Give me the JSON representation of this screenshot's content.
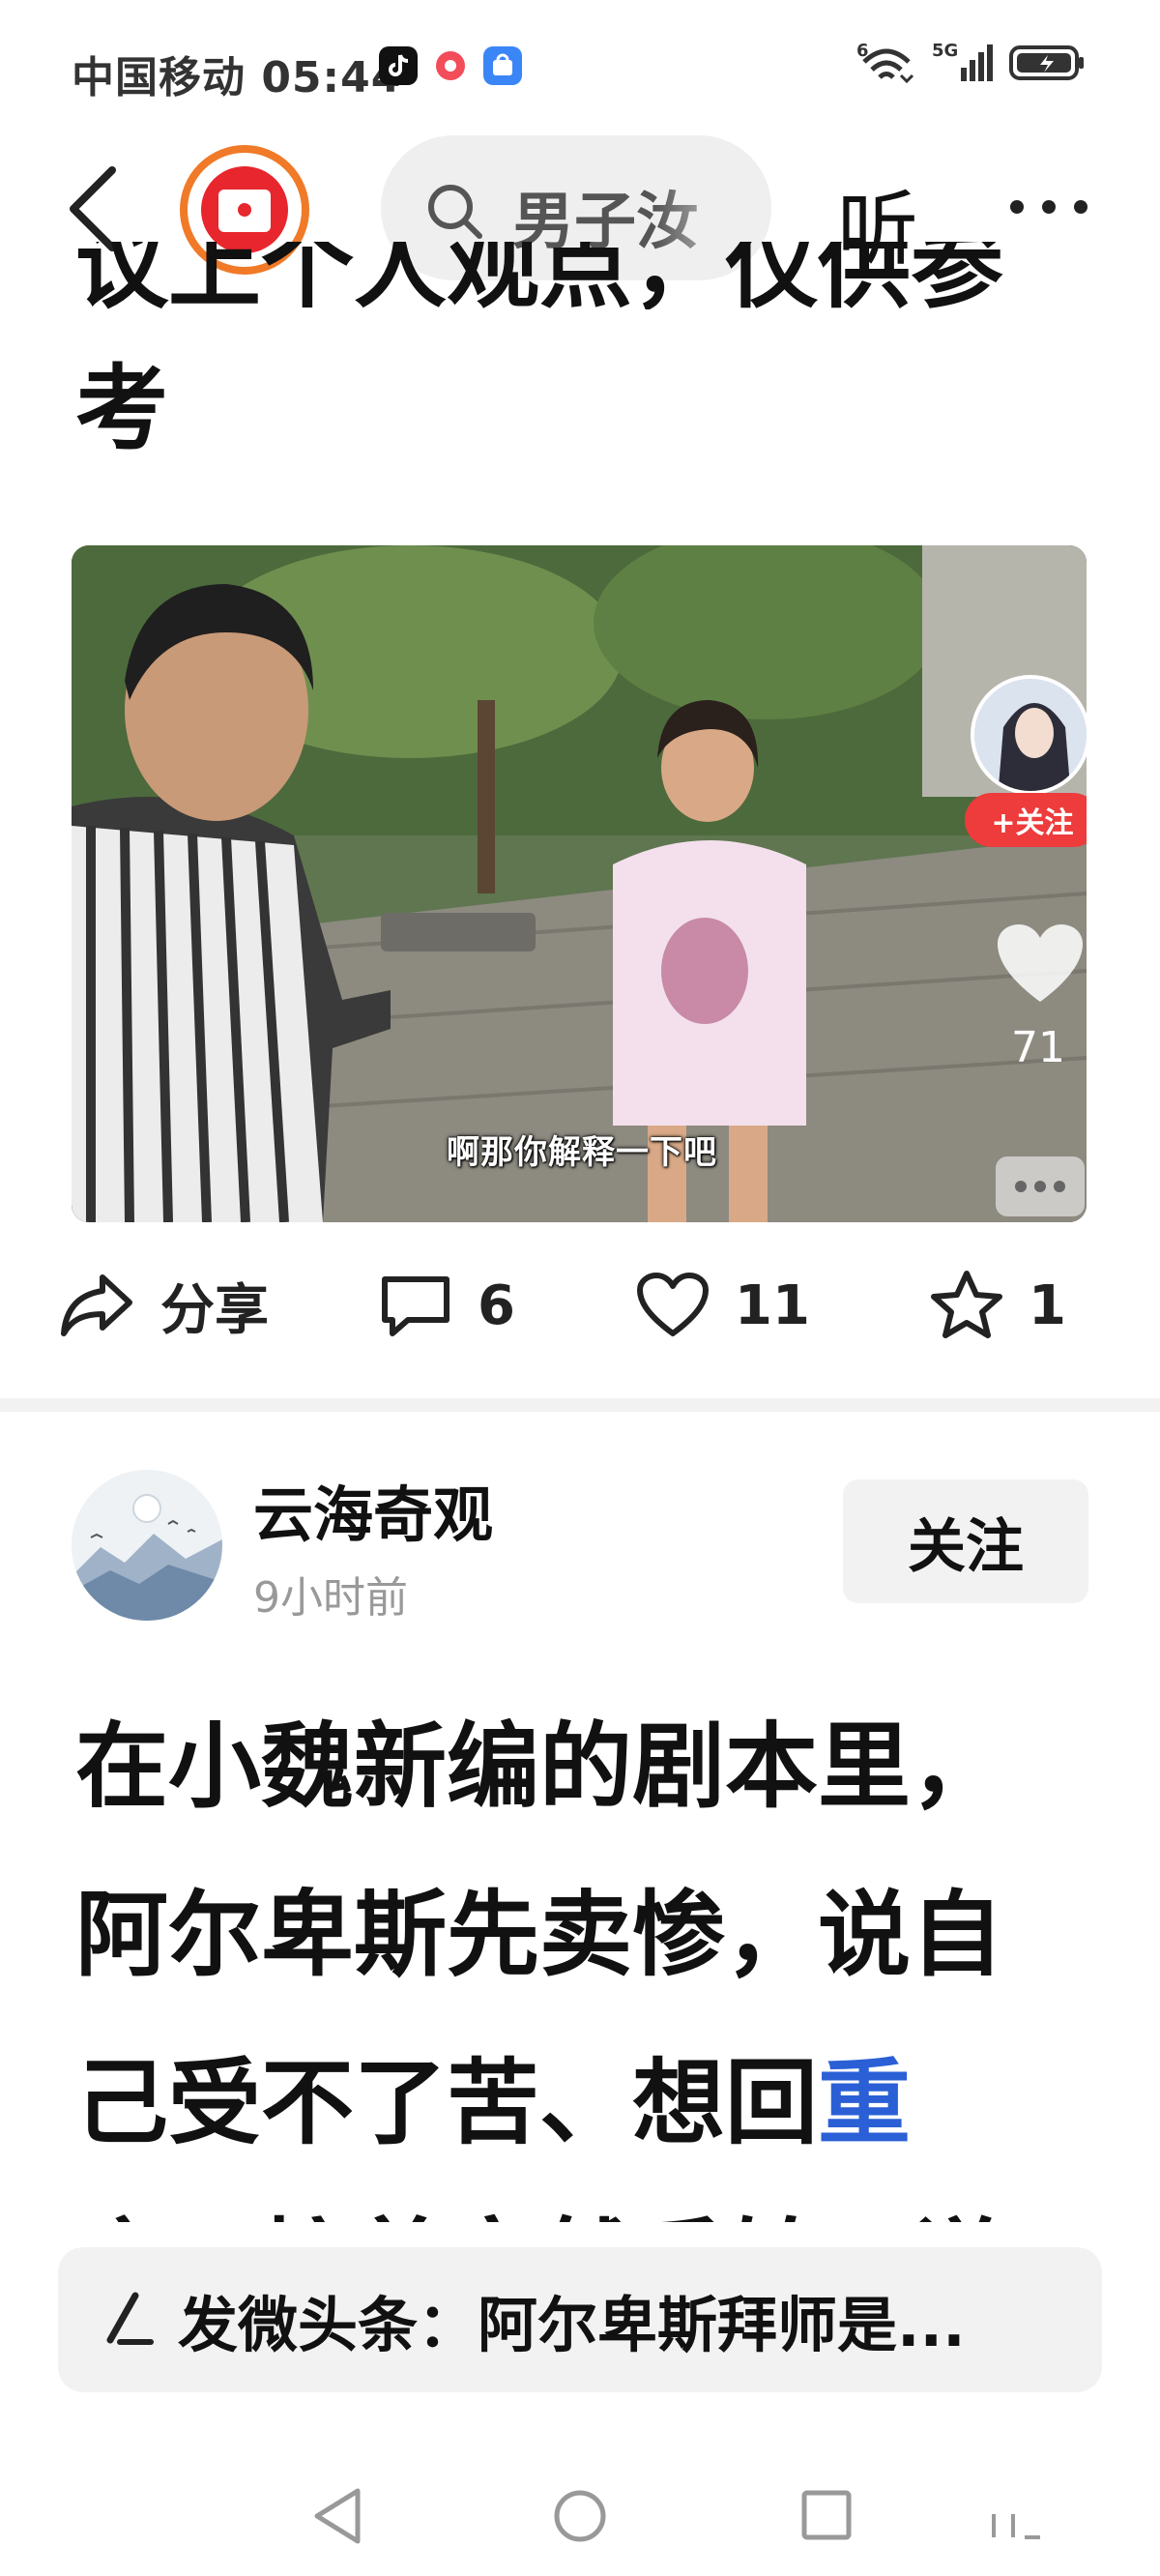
{
  "status_bar": {
    "carrier_time": "中国移动 05:44",
    "signal_badge": "5G",
    "wifi_badge": "6",
    "app_icons": [
      "tiktok-icon",
      "music-icon",
      "app-market-icon"
    ]
  },
  "nav": {
    "search_text": "男子汝",
    "listen_label": "听"
  },
  "article1": {
    "title_clipped": "议上个人观点，仅供参",
    "title_tail": "考",
    "video": {
      "subtitle": "啊那你解释一下吧",
      "follow_label": "+关注",
      "like_count": "71"
    },
    "actions": {
      "share_label": "分享",
      "comment_count": "6",
      "like_count": "11",
      "favorite_count": "1"
    }
  },
  "article2": {
    "author_name": "云海奇观",
    "post_time": "9小时前",
    "follow_label": "关注",
    "body_lines": [
      "在小魏新编的剧本里，",
      "阿尔卑斯先卖惨，说自"
    ],
    "line3_text": "己受不了苦、想回",
    "line3_link": "重",
    "clipped_line": "庆，接着突然反转，说"
  },
  "post_bar": {
    "text": "发微头条：阿尔卑斯拜师是..."
  },
  "colors": {
    "accent_orange": "#f07a28",
    "brand_red": "#e8262d",
    "link_blue": "#2a5fd6",
    "follow_red": "#ee3b3b"
  }
}
